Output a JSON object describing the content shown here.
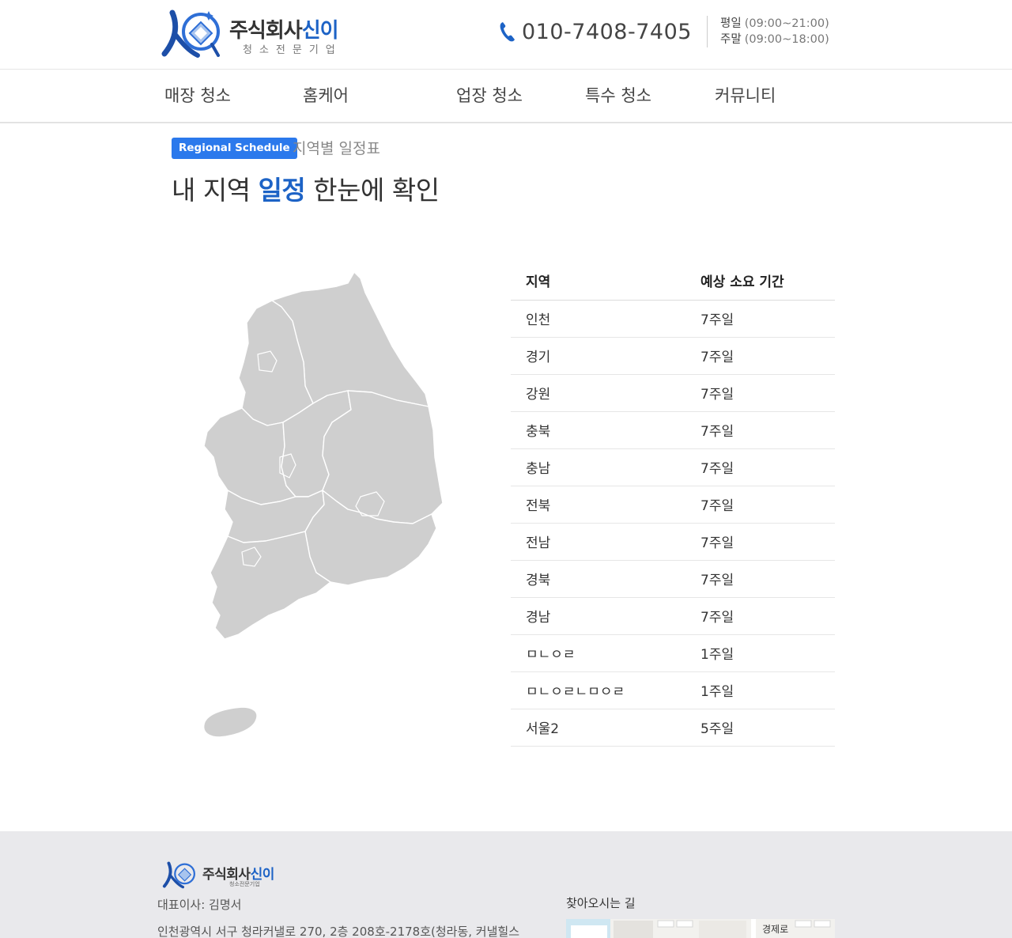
{
  "header": {
    "logo_name_main": "주식회사",
    "logo_name_accent": "신이",
    "logo_sub": "청소전문기업",
    "phone": "010-7408-7405",
    "hours": [
      {
        "label": "평일",
        "time": "(09:00~21:00)"
      },
      {
        "label": "주말",
        "time": "(09:00~18:00)"
      }
    ]
  },
  "nav": {
    "items": [
      "매장 청소",
      "홈케어",
      "업장 청소",
      "특수 청소",
      "커뮤니티"
    ]
  },
  "section": {
    "tag": "Regional Schedule",
    "tag_desc": "지역별 일정표",
    "heading_pre": "내 지역 ",
    "heading_hl": "일정",
    "heading_post": " 한눈에 확인"
  },
  "table": {
    "headers": [
      "지역",
      "예상 소요 기간"
    ],
    "rows": [
      [
        "인천",
        "7주일"
      ],
      [
        "경기",
        "7주일"
      ],
      [
        "강원",
        "7주일"
      ],
      [
        "충북",
        "7주일"
      ],
      [
        "충남",
        "7주일"
      ],
      [
        "전북",
        "7주일"
      ],
      [
        "전남",
        "7주일"
      ],
      [
        "경북",
        "7주일"
      ],
      [
        "경남",
        "7주일"
      ],
      [
        "ㅁㄴㅇㄹ",
        "1주일"
      ],
      [
        "ㅁㄴㅇㄹㄴㅁㅇㄹ",
        "1주일"
      ],
      [
        "서울2",
        "5주일"
      ]
    ]
  },
  "footer": {
    "logo_name_main": "주식회사",
    "logo_name_accent": "신이",
    "logo_sub": "청소전문기업",
    "ceo": "대표이사: 김명서",
    "address": "인천광역시 서구 청라커낼로 270, 2층 208호-2178호(청라동, 커낼힐스",
    "directions": "찾아오시는 길",
    "map_label": "경제로"
  },
  "colors": {
    "accent": "#1d63c6",
    "tag_bg": "#2b79ec",
    "map_fill": "#cfcfcf",
    "footer_bg": "#e9e9ec"
  }
}
